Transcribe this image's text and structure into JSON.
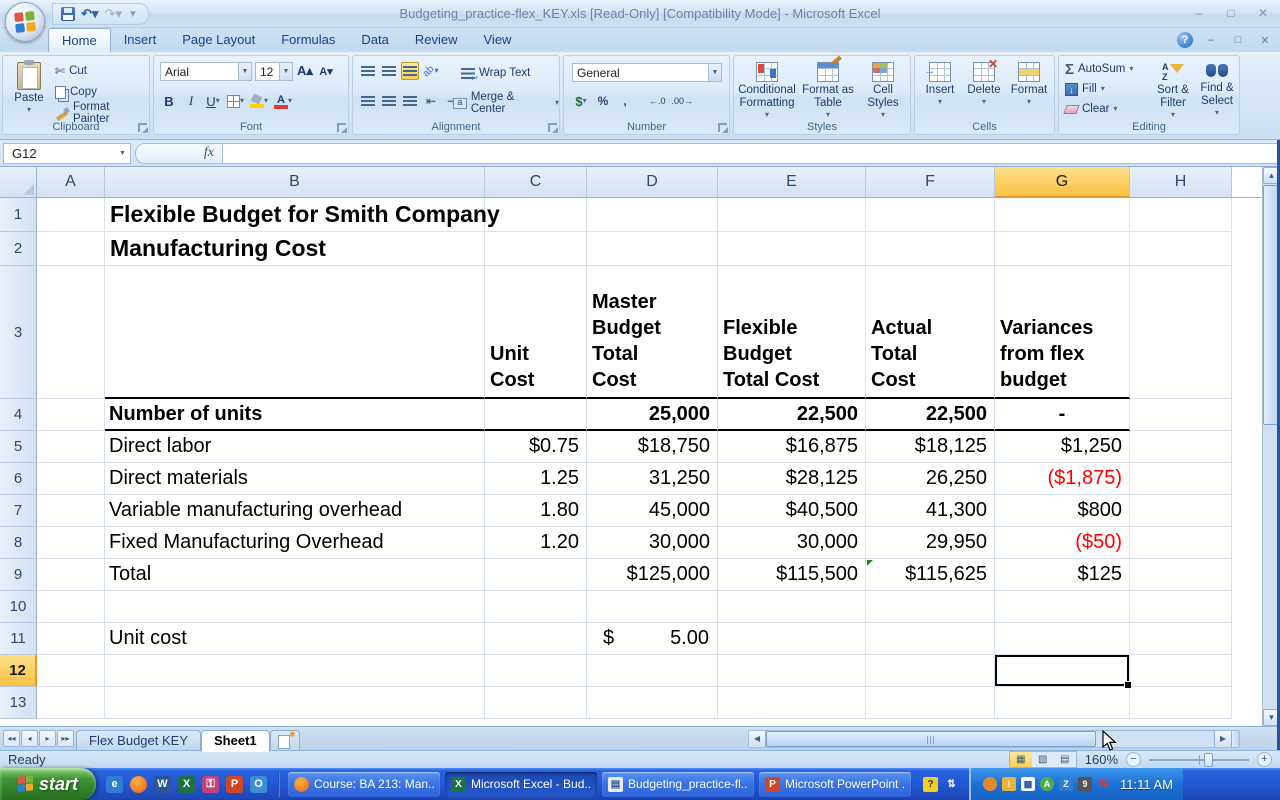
{
  "window": {
    "title": "Budgeting_practice-flex_KEY.xls  [Read-Only]  [Compatibility Mode] - Microsoft Excel"
  },
  "ribbon": {
    "tabs": [
      "Home",
      "Insert",
      "Page Layout",
      "Formulas",
      "Data",
      "Review",
      "View"
    ],
    "active_tab": "Home",
    "groups": {
      "clipboard": {
        "label": "Clipboard",
        "paste": "Paste",
        "cut": "Cut",
        "copy": "Copy",
        "format_painter": "Format Painter"
      },
      "font": {
        "label": "Font",
        "font_name": "Arial",
        "font_size": "12"
      },
      "alignment": {
        "label": "Alignment",
        "wrap_text": "Wrap Text",
        "merge_center": "Merge & Center"
      },
      "number": {
        "label": "Number",
        "format": "General"
      },
      "styles": {
        "label": "Styles",
        "conditional": "Conditional Formatting",
        "format_table": "Format as Table",
        "cell_styles": "Cell Styles"
      },
      "cells": {
        "label": "Cells",
        "insert": "Insert",
        "delete": "Delete",
        "format": "Format"
      },
      "editing": {
        "label": "Editing",
        "autosum": "AutoSum",
        "fill": "Fill",
        "clear": "Clear",
        "sort_filter": "Sort & Filter",
        "find_select": "Find & Select"
      }
    }
  },
  "formula_bar": {
    "name_box": "G12",
    "fx_label": "fx",
    "formula": ""
  },
  "grid": {
    "columns": [
      "A",
      "B",
      "C",
      "D",
      "E",
      "F",
      "G",
      "H"
    ],
    "selected_column": "G",
    "selected_row": "12",
    "selected_cell": "G12",
    "rows": [
      {
        "n": "1",
        "h": 34,
        "cells": [
          {
            "c": "B",
            "t": "Flexible Budget for Smith Company",
            "cls": "title"
          }
        ]
      },
      {
        "n": "2",
        "h": 34,
        "cells": [
          {
            "c": "B",
            "t": "Manufacturing Cost",
            "cls": "title"
          }
        ]
      },
      {
        "n": "3",
        "h": 133,
        "rule": true,
        "cells": [
          {
            "c": "C",
            "t": "Unit\nCost",
            "cls": "colhead"
          },
          {
            "c": "D",
            "t": "Master\nBudget\nTotal\nCost",
            "cls": "colhead"
          },
          {
            "c": "E",
            "t": "Flexible\nBudget\nTotal Cost",
            "cls": "colhead"
          },
          {
            "c": "F",
            "t": "Actual\nTotal\nCost",
            "cls": "colhead"
          },
          {
            "c": "G",
            "t": "Variances\nfrom flex\nbudget",
            "cls": "colhead"
          }
        ]
      },
      {
        "n": "4",
        "h": 32,
        "rule": true,
        "cells": [
          {
            "c": "B",
            "t": "Number of units",
            "cls": "bold"
          },
          {
            "c": "D",
            "t": "25,000",
            "cls": "num bold"
          },
          {
            "c": "E",
            "t": "22,500",
            "cls": "num bold"
          },
          {
            "c": "F",
            "t": "22,500",
            "cls": "num bold"
          },
          {
            "c": "G",
            "t": "-",
            "cls": "bold center"
          }
        ]
      },
      {
        "n": "5",
        "h": 32,
        "cells": [
          {
            "c": "B",
            "t": "Direct labor"
          },
          {
            "c": "C",
            "t": "$0.75",
            "cls": "num"
          },
          {
            "c": "D",
            "t": "$18,750",
            "cls": "num"
          },
          {
            "c": "E",
            "t": "$16,875",
            "cls": "num"
          },
          {
            "c": "F",
            "t": "$18,125",
            "cls": "num"
          },
          {
            "c": "G",
            "t": "$1,250",
            "cls": "num"
          }
        ]
      },
      {
        "n": "6",
        "h": 32,
        "cells": [
          {
            "c": "B",
            "t": "Direct materials"
          },
          {
            "c": "C",
            "t": "1.25",
            "cls": "num"
          },
          {
            "c": "D",
            "t": "31,250",
            "cls": "num"
          },
          {
            "c": "E",
            "t": "$28,125",
            "cls": "num"
          },
          {
            "c": "F",
            "t": "26,250",
            "cls": "num"
          },
          {
            "c": "G",
            "t": "($1,875)",
            "cls": "num red"
          }
        ]
      },
      {
        "n": "7",
        "h": 32,
        "cells": [
          {
            "c": "B",
            "t": "Variable manufacturing overhead"
          },
          {
            "c": "C",
            "t": "1.80",
            "cls": "num"
          },
          {
            "c": "D",
            "t": "45,000",
            "cls": "num"
          },
          {
            "c": "E",
            "t": "$40,500",
            "cls": "num"
          },
          {
            "c": "F",
            "t": "41,300",
            "cls": "num"
          },
          {
            "c": "G",
            "t": "$800",
            "cls": "num"
          }
        ]
      },
      {
        "n": "8",
        "h": 32,
        "cells": [
          {
            "c": "B",
            "t": "Fixed Manufacturing Overhead"
          },
          {
            "c": "C",
            "t": "1.20",
            "cls": "num"
          },
          {
            "c": "D",
            "t": "30,000",
            "cls": "num"
          },
          {
            "c": "E",
            "t": "30,000",
            "cls": "num"
          },
          {
            "c": "F",
            "t": "29,950",
            "cls": "num"
          },
          {
            "c": "G",
            "t": "($50)",
            "cls": "num red"
          }
        ]
      },
      {
        "n": "9",
        "h": 32,
        "cells": [
          {
            "c": "B",
            "t": "Total"
          },
          {
            "c": "D",
            "t": "$125,000",
            "cls": "num"
          },
          {
            "c": "E",
            "t": "$115,500",
            "cls": "num"
          },
          {
            "c": "F",
            "t": "$115,625",
            "cls": "num",
            "flag": "green"
          },
          {
            "c": "G",
            "t": "$125",
            "cls": "num"
          }
        ]
      },
      {
        "n": "10",
        "h": 32,
        "cells": []
      },
      {
        "n": "11",
        "h": 32,
        "cells": [
          {
            "c": "B",
            "t": "Unit cost"
          },
          {
            "c": "D",
            "t": "$|5.00",
            "cls": "acct"
          }
        ]
      },
      {
        "n": "12",
        "h": 32,
        "cells": []
      },
      {
        "n": "13",
        "h": 32,
        "cells": []
      }
    ]
  },
  "sheet_tabs": {
    "tabs": [
      "Flex Budget KEY",
      "Sheet1"
    ],
    "active": "Sheet1"
  },
  "status_bar": {
    "mode": "Ready",
    "zoom": "160%"
  },
  "taskbar": {
    "start_label": "start",
    "buttons": [
      "Course: BA 213: Man...",
      "Microsoft Excel - Bud...",
      "Budgeting_practice-fl...",
      "Microsoft PowerPoint ..."
    ],
    "active_button": "Microsoft Excel - Bud...",
    "time": "11:11 AM"
  },
  "colors": {
    "negative": "#ff0000",
    "selection_header": "#f9c13f",
    "taskbar_blue": "#2258d8"
  }
}
